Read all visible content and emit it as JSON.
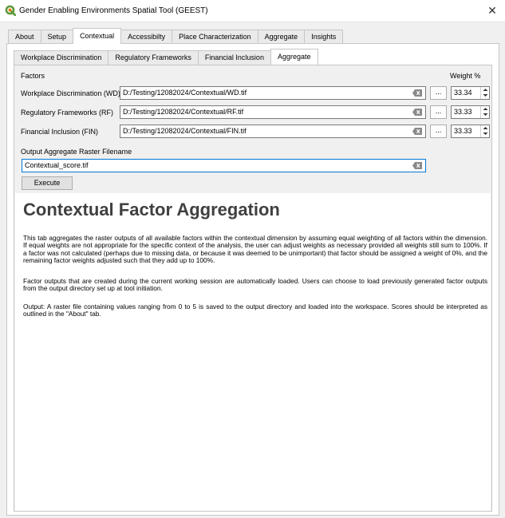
{
  "window": {
    "title": "Gender Enabling Environments Spatial Tool (GEEST)",
    "close_glyph": "✕",
    "app_icon": "qgis-logo-icon",
    "brand_color": "#589632"
  },
  "main_tabs": [
    {
      "label": "About",
      "active": false
    },
    {
      "label": "Setup",
      "active": false
    },
    {
      "label": "Contextual",
      "active": true
    },
    {
      "label": "Accessibilty",
      "active": false
    },
    {
      "label": "Place Characterization",
      "active": false
    },
    {
      "label": "Aggregate",
      "active": false
    },
    {
      "label": "Insights",
      "active": false
    }
  ],
  "sub_tabs": [
    {
      "label": "Workplace Discrimination",
      "active": false
    },
    {
      "label": "Regulatory Frameworks",
      "active": false
    },
    {
      "label": "Financial Inclusion",
      "active": false
    },
    {
      "label": "Aggregate",
      "active": true
    }
  ],
  "form": {
    "factors_header": "Factors",
    "weight_header": "Weight %",
    "browse_label": "...",
    "factors": [
      {
        "label": "Workplace Discrimination (WD)",
        "path": "D:/Testing/12082024/Contextual/WD.tif",
        "weight": "33.34"
      },
      {
        "label": "Regulatory Frameworks (RF)",
        "path": "D:/Testing/12082024/Contextual/RF.tif",
        "weight": "33.33"
      },
      {
        "label": "Financial Inclusion (FIN)",
        "path": "D:/Testing/12082024/Contextual/FIN.tif",
        "weight": "33.33"
      }
    ],
    "output_label": "Output Aggregate Raster Filename",
    "output_value": "Contextual_score.tif",
    "execute_label": "Execute",
    "focus_color": "#0078d7"
  },
  "description": {
    "title": "Contextual Factor Aggregation",
    "paragraphs": [
      "This tab aggregates the raster outputs of all available factors within the contextual dimension by assuming equal weighting of all factors within the dimension. If equal weights are not appropriate for the specific context of the analysis, the user can adjust weights as necessary provided all weights still sum to 100%. If a factor was not calculated (perhaps due to missing data, or because it was deemed to be unimportant) that factor should be assigned a weight of 0%, and the remaining factor weights adjusted such that they add up to 100%.",
      "Factor outputs that are created during the current working session are automatically loaded. Users can choose to load previously generated factor outputs from the output directory set up at tool initiation.",
      "Output: A raster file containing values ranging from 0 to 5 is saved to the output directory and loaded into the workspace. Scores should be interpreted as outlined in the \"About\" tab."
    ]
  }
}
